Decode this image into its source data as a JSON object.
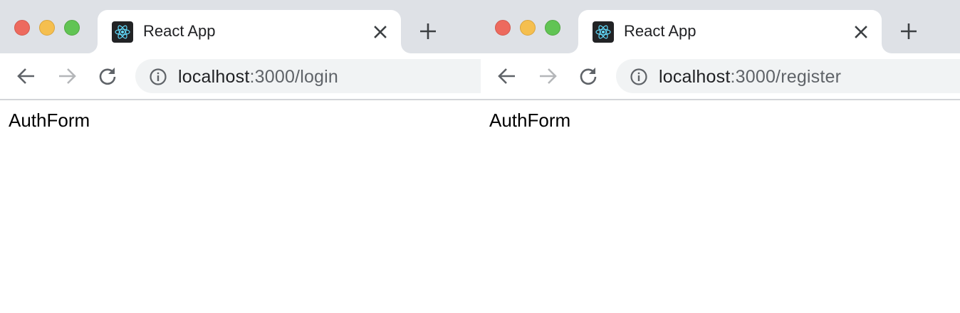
{
  "windows": [
    {
      "tab": {
        "title": "React App",
        "favicon": "react-logo-icon"
      },
      "address": {
        "host": "localhost",
        "path": ":3000/login"
      },
      "page": {
        "text": "AuthForm"
      }
    },
    {
      "tab": {
        "title": "React App",
        "favicon": "react-logo-icon"
      },
      "address": {
        "host": "localhost",
        "path": ":3000/register"
      },
      "page": {
        "text": "AuthForm"
      }
    }
  ],
  "icons": {
    "close": "close-icon",
    "new_tab": "plus-icon",
    "back": "arrow-left-icon",
    "forward": "arrow-right-icon",
    "reload": "reload-icon",
    "site_info": "info-icon"
  },
  "colors": {
    "tabstrip": "#dee1e6",
    "omnibox": "#f1f3f4",
    "close_traffic": "#ed6a5e",
    "minimize_traffic": "#f5bf4f",
    "zoom_traffic": "#61c454",
    "react_blue": "#61dafb"
  }
}
